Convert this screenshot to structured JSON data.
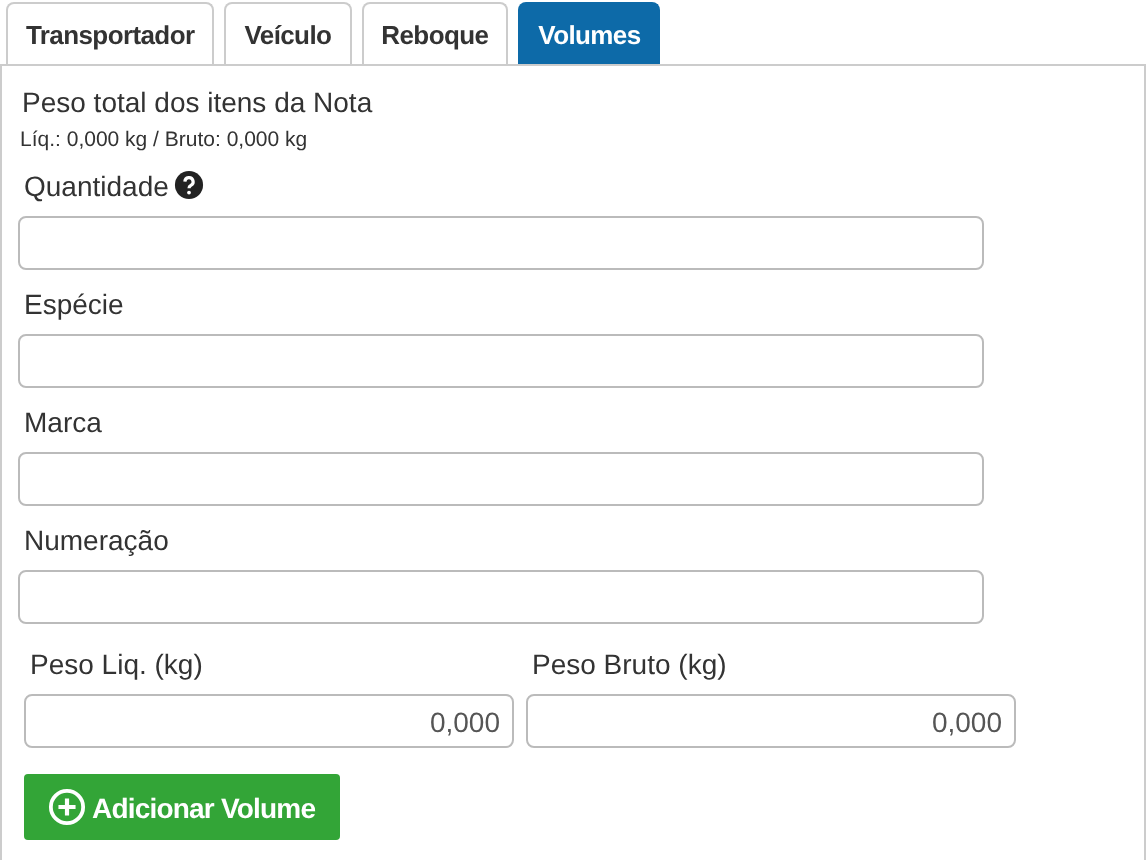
{
  "tabs": [
    {
      "label": "Transportador",
      "selected": false
    },
    {
      "label": "Veículo",
      "selected": false
    },
    {
      "label": "Reboque",
      "selected": false
    },
    {
      "label": "Volumes",
      "selected": true
    }
  ],
  "summary": {
    "title": "Peso total dos itens da Nota",
    "detail": "Líq.: 0,000 kg / Bruto: 0,000 kg"
  },
  "fields": [
    {
      "label": "Quantidade",
      "help": true
    },
    {
      "label": "Espécie",
      "help": false
    },
    {
      "label": "Marca",
      "help": false
    },
    {
      "label": "Numeração",
      "help": false
    }
  ],
  "weights": [
    {
      "label": "Peso Liq. (kg)",
      "value": "0,000"
    },
    {
      "label": "Peso Bruto (kg)",
      "value": "0,000"
    }
  ],
  "add_button": {
    "label": "Adicionar Volume"
  }
}
